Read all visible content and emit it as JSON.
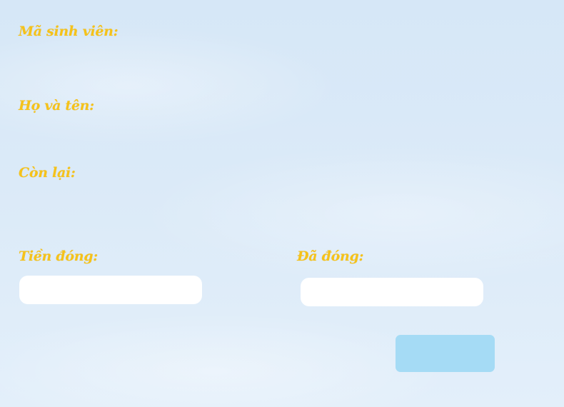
{
  "labels": {
    "ma_sinh_vien": "Mã sinh viên:",
    "ho_va_ten": "Họ và tên:",
    "con_lai": "Còn lại:",
    "tien_dong": "Tiền đóng:",
    "da_dong": "Đã đóng:"
  },
  "fields": {
    "tien_dong_value": "",
    "da_dong_value": ""
  },
  "actions": {
    "submit_label": ""
  },
  "colors": {
    "label": "#f5c21a",
    "button": "#a5dbf5",
    "field": "#ffffff"
  }
}
